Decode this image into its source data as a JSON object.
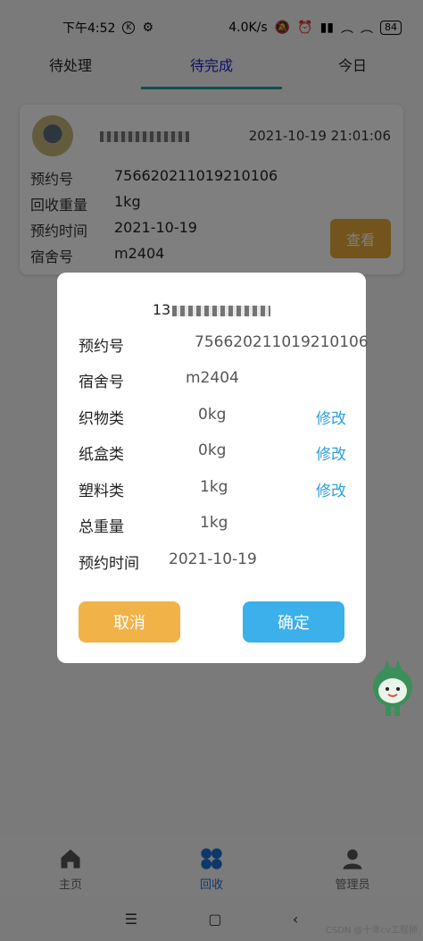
{
  "status": {
    "time": "下午4:52",
    "k_badge": "K",
    "net_speed": "4.0K/s",
    "battery": "84"
  },
  "tabs": [
    {
      "label": "待处理",
      "active": false
    },
    {
      "label": "待完成",
      "active": true
    },
    {
      "label": "今日",
      "active": false
    }
  ],
  "card": {
    "timestamp": "2021-10-19 21:01:06",
    "rows": [
      {
        "label": "预约号",
        "value": "756620211019210106"
      },
      {
        "label": "回收重量",
        "value": "1kg"
      },
      {
        "label": "预约时间",
        "value": "2021-10-19"
      },
      {
        "label": "宿舍号",
        "value": "m2404"
      }
    ],
    "view_button": "查看"
  },
  "dialog": {
    "title_prefix": "13",
    "rows": [
      {
        "label": "预约号",
        "value": "756620211019210106"
      },
      {
        "label": "宿舍号",
        "value": "m2404"
      },
      {
        "label": "织物类",
        "value": "0kg",
        "edit": "修改"
      },
      {
        "label": "纸盒类",
        "value": "0kg",
        "edit": "修改"
      },
      {
        "label": "塑料类",
        "value": "1kg",
        "edit": "修改"
      },
      {
        "label": "总重量",
        "value": "1kg"
      },
      {
        "label": "预约时间",
        "value": "2021-10-19"
      }
    ],
    "cancel_label": "取消",
    "ok_label": "确定"
  },
  "bottom_nav": [
    {
      "label": "主页",
      "icon": "home-icon",
      "active": false
    },
    {
      "label": "回收",
      "icon": "grid-icon",
      "active": true
    },
    {
      "label": "管理员",
      "icon": "user-icon",
      "active": false
    }
  ],
  "watermark": "CSDN @十年cv工程师",
  "colors": {
    "accent_blue": "#3bb0ea",
    "cancel_orange": "#f1b248",
    "edit_link": "#2f9fd6"
  }
}
